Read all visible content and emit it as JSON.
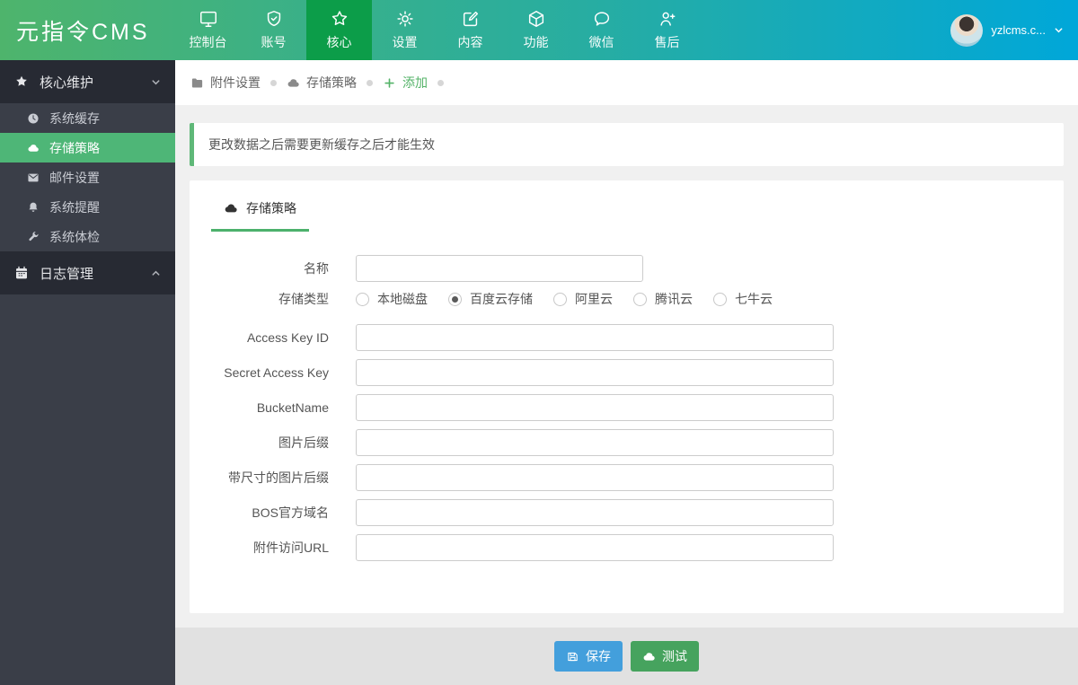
{
  "header": {
    "logo": "元指令CMS",
    "nav": [
      {
        "label": "控制台",
        "icon": "monitor-icon"
      },
      {
        "label": "账号",
        "icon": "shield-icon"
      },
      {
        "label": "核心",
        "icon": "star-icon",
        "active": true
      },
      {
        "label": "设置",
        "icon": "gear-icon"
      },
      {
        "label": "内容",
        "icon": "edit-icon"
      },
      {
        "label": "功能",
        "icon": "cube-icon"
      },
      {
        "label": "微信",
        "icon": "chat-icon"
      },
      {
        "label": "售后",
        "icon": "user-plus-icon"
      }
    ],
    "user": {
      "name": "yzlcms.c..."
    }
  },
  "sidebar": {
    "sections": [
      {
        "label": "核心维护",
        "icon": "star-icon",
        "expanded": true,
        "items": [
          {
            "label": "系统缓存",
            "icon": "clock-icon",
            "active": false
          },
          {
            "label": "存储策略",
            "icon": "cloud-icon",
            "active": true
          },
          {
            "label": "邮件设置",
            "icon": "envelope-icon",
            "active": false
          },
          {
            "label": "系统提醒",
            "icon": "bell-icon",
            "active": false
          },
          {
            "label": "系统体检",
            "icon": "wrench-icon",
            "active": false
          }
        ]
      },
      {
        "label": "日志管理",
        "icon": "calendar-icon",
        "expanded": false,
        "items": []
      }
    ]
  },
  "breadcrumb": {
    "items": [
      "附件设置",
      "存储策略"
    ],
    "add": "添加"
  },
  "alert": {
    "text": "更改数据之后需要更新缓存之后才能生效"
  },
  "panel": {
    "tab": "存储策略"
  },
  "form": {
    "fields": [
      {
        "label": "名称",
        "value": ""
      },
      {
        "label": "存储类型",
        "options": [
          "本地磁盘",
          "百度云存储",
          "阿里云",
          "腾讯云",
          "七牛云"
        ],
        "selected": "百度云存储"
      },
      {
        "label": "Access Key ID",
        "value": ""
      },
      {
        "label": "Secret Access Key",
        "value": ""
      },
      {
        "label": "BucketName",
        "value": ""
      },
      {
        "label": "图片后缀",
        "value": ""
      },
      {
        "label": "带尺寸的图片后缀",
        "value": ""
      },
      {
        "label": "BOS官方域名",
        "value": ""
      },
      {
        "label": "附件访问URL",
        "value": ""
      }
    ]
  },
  "footer": {
    "save_label": "保存",
    "test_label": "测试"
  },
  "colors": {
    "header_gradient_start": "#4eb46c",
    "header_gradient_end": "#00a7d9",
    "active_nav_green": "#0c9d49",
    "sidebar_dark": "#272a33",
    "sidebar_sub": "#3a3e48",
    "active_item_green": "#4eb677",
    "alert_border_green": "#5FB878",
    "tab_underline_green": "#4cb16c",
    "save_button_blue": "#439fdc",
    "test_button_green": "#46a35e"
  }
}
